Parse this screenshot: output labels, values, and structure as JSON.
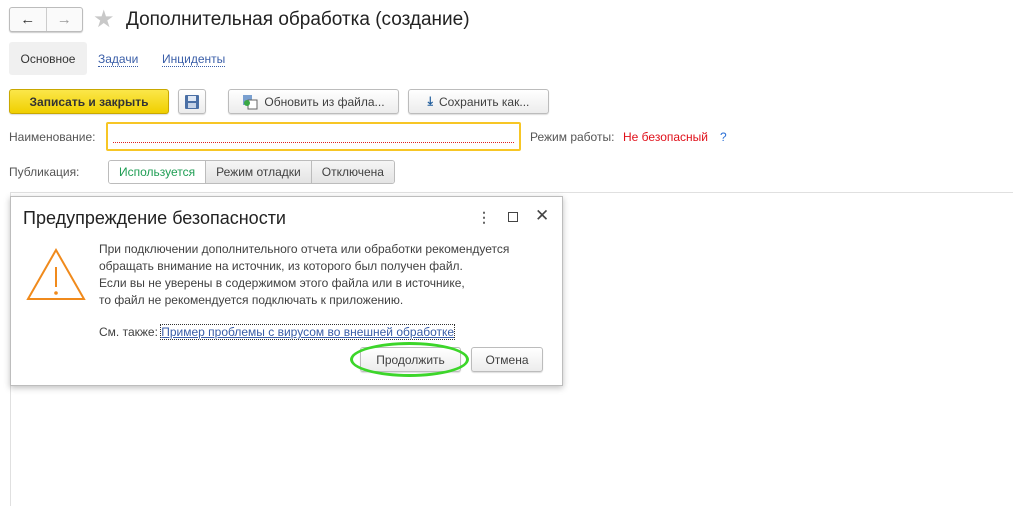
{
  "header": {
    "title": "Дополнительная обработка (создание)",
    "back": "←",
    "forward": "→"
  },
  "tabs": [
    {
      "label": "Основное"
    },
    {
      "label": "Задачи"
    },
    {
      "label": "Инциденты"
    }
  ],
  "toolbar": {
    "save_close": "Записать и закрыть",
    "update_from_file": "Обновить из файла...",
    "save_as": "Сохранить как..."
  },
  "form": {
    "name_label": "Наименование:",
    "name_value": "",
    "mode_label": "Режим работы:",
    "mode_value": "Не безопасный",
    "help": "?",
    "publication_label": "Публикация:",
    "publication_options": [
      "Используется",
      "Режим отладки",
      "Отключена"
    ],
    "publication_selected": "Используется"
  },
  "dialog": {
    "title": "Предупреждение безопасности",
    "lines": [
      "При подключении дополнительного отчета или обработки рекомендуется",
      "обращать внимание на источник, из которого был получен файл.",
      "Если вы не уверены в содержимом этого файла или в источнике,",
      "то файл не рекомендуется подключать к приложению."
    ],
    "see_also": "См. также:",
    "link": "Пример проблемы с вирусом во внешней обработке",
    "continue": "Продолжить",
    "cancel": "Отмена"
  },
  "colors": {
    "accent_yellow": "#f0cf00",
    "warning": "#f08a1c",
    "danger": "#e0101a",
    "highlight": "#3cd62a"
  }
}
